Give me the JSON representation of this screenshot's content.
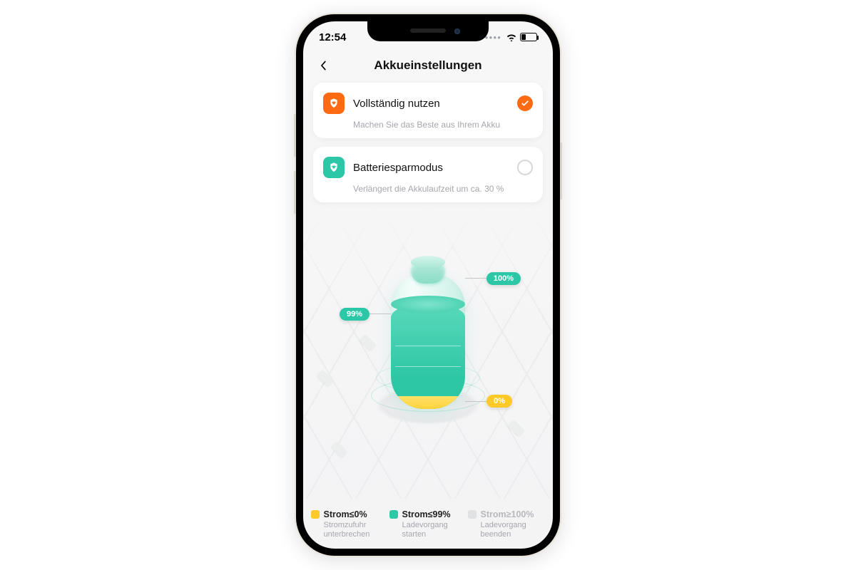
{
  "statusbar": {
    "time": "12:54"
  },
  "header": {
    "title": "Akkueinstellungen"
  },
  "options": [
    {
      "title": "Vollständig nutzen",
      "subtitle": "Machen Sie das Beste aus Ihrem Akku",
      "selected": true,
      "icon": "plug-shield-icon",
      "color": "#ff6a13"
    },
    {
      "title": "Batteriesparmodus",
      "subtitle": "Verlängert die Akkulaufzeit um ca. 30 %",
      "selected": false,
      "icon": "plug-shield-icon",
      "color": "#2bc7a7"
    }
  ],
  "battery_graphic": {
    "labels": {
      "top": "100%",
      "mid": "99%",
      "bottom": "0%"
    },
    "colors": {
      "full": "#2bc7a7",
      "low": "#ffc928"
    }
  },
  "legend": [
    {
      "swatch": "#ffc928",
      "title": "Strom≤0%",
      "sub": "Stromzufuhr unterbrechen",
      "dim": false
    },
    {
      "swatch": "#2bc7a7",
      "title": "Strom≤99%",
      "sub": "Ladevorgang starten",
      "dim": false
    },
    {
      "swatch": "#e0e1e3",
      "title": "Strom≥100%",
      "sub": "Ladevorgang beenden",
      "dim": true
    }
  ]
}
